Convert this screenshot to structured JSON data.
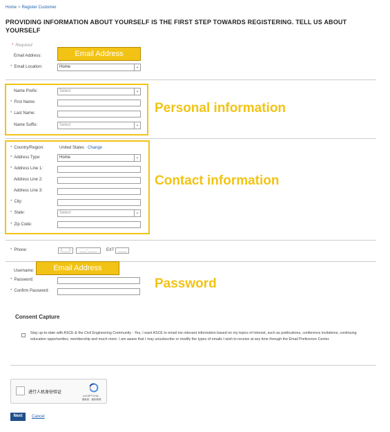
{
  "breadcrumb": {
    "home": "Home",
    "separator": ">",
    "current": "Register Customer"
  },
  "heading": "PROVIDING INFORMATION ABOUT YOURSELF IS THE FIRST STEP TOWARDS REGISTERING. TELL US ABOUT YOURSELF",
  "required_note": "Required",
  "email": {
    "label": "Email Address:",
    "highlight": "Email Address",
    "location_label": "Email Location:",
    "location_value": "Home"
  },
  "personal": {
    "section_title": "Personal information",
    "name_prefix_label": "Name Prefix:",
    "name_prefix_value": "Select",
    "first_name_label": "First Name:",
    "last_name_label": "Last Name:",
    "name_suffix_label": "Name Suffix:",
    "name_suffix_value": "Select"
  },
  "contact": {
    "section_title": "Contact information",
    "country_label": "Country/Region:",
    "country_value": "United States",
    "change_link": "Change",
    "address_type_label": "Address Type:",
    "address_type_value": "Home",
    "address1_label": "Address Line 1:",
    "address2_label": "Address Line 2:",
    "address3_label": "Address Line 3:",
    "city_label": "City:",
    "state_label": "State:",
    "state_value": "Select",
    "zip_label": "Zip Code:"
  },
  "phone": {
    "label": "Phone:",
    "area_placeholder": "(___)",
    "number_placeholder": "___-____",
    "ext_label": "EXT",
    "ext_placeholder": "____"
  },
  "credentials": {
    "section_title": "Password",
    "username_label": "Username:",
    "username_highlight": "Email Address",
    "password_label": "Password:",
    "confirm_label": "Confirm Password:"
  },
  "consent": {
    "title": "Consent Capture",
    "text": "Stay up-to-date with ASCE & the Civil Engineering Community - Yes, I want ASCE to email me relevant information based on my topics of interest, such as publications, conference invitations, continuing education opportunities, membership and much more. I am aware that I may unsubscribe or modify the types of emails I wish to receive at any time through the Email Preference Center."
  },
  "captcha": {
    "label": "进行人机身份验证",
    "brand": "reCAPTCHA",
    "links": "隐私权 - 使用条款"
  },
  "actions": {
    "next": "Next",
    "cancel": "Cancel"
  },
  "colors": {
    "highlight": "#f2c314",
    "link": "#1f5fa8",
    "required": "#c0392b",
    "button": "#1e4f8c"
  },
  "icons": {
    "dropdown": "chevron-down-icon",
    "captcha": "recaptcha-icon"
  }
}
